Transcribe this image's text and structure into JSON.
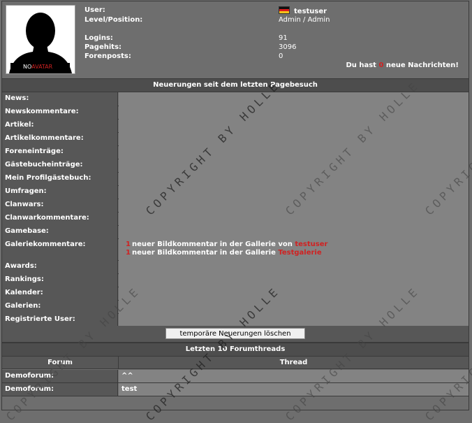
{
  "profile": {
    "avatar_text_prefix": "NO",
    "avatar_text_highlight": "AVATAR",
    "user_label": "User:",
    "user_value": "testuser",
    "level_label": "Level/Position:",
    "level_value": "Admin / Admin",
    "logins_label": "Logins:",
    "logins_value": "91",
    "pagehits_label": "Pagehits:",
    "pagehits_value": "3096",
    "forenposts_label": "Forenposts:",
    "forenposts_value": "0",
    "messages_prefix": "Du hast",
    "messages_count": "0",
    "messages_suffix": "neue Nachrichten!"
  },
  "news_section": {
    "title": "Neuerungen seit dem letzten Pagebesuch",
    "rows": [
      {
        "label": "News:"
      },
      {
        "label": "Newskommentare:"
      },
      {
        "label": "Artikel:"
      },
      {
        "label": "Artikelkommentare:"
      },
      {
        "label": "Foreneinträge:"
      },
      {
        "label": "Gästebucheinträge:"
      },
      {
        "label": "Mein Profilgästebuch:"
      },
      {
        "label": "Umfragen:"
      },
      {
        "label": "Clanwars:"
      },
      {
        "label": "Clanwarkommentare:"
      },
      {
        "label": "Gamebase:"
      },
      {
        "label": "Galeriekommentare:"
      },
      {
        "label": "Awards:"
      },
      {
        "label": "Rankings:"
      },
      {
        "label": "Kalender:"
      },
      {
        "label": "Galerien:"
      },
      {
        "label": "Registrierte User:"
      }
    ],
    "gallery_comments": [
      {
        "count": "1",
        "text": "neuer Bildkommentar in der Gallerie von",
        "link": "testuser"
      },
      {
        "count": "1",
        "text": "neuer Bildkommentar in der Gallerie",
        "link": "Testgalerie"
      }
    ],
    "clear_button": "temporäre Neuerungen löschen"
  },
  "forum_section": {
    "title": "Letzten 10 Forumthreads",
    "col_forum": "Forum",
    "col_thread": "Thread",
    "threads": [
      {
        "forum": "Demoforum:",
        "thread": "^^"
      },
      {
        "forum": "Demoforum:",
        "thread": "test"
      }
    ]
  },
  "watermark": "COPYRIGHT BY HOLLE",
  "colors": {
    "accent_red": "#d02222",
    "header_bg": "#4d4d4d",
    "label_bg": "#575757",
    "value_bg": "#838383"
  }
}
